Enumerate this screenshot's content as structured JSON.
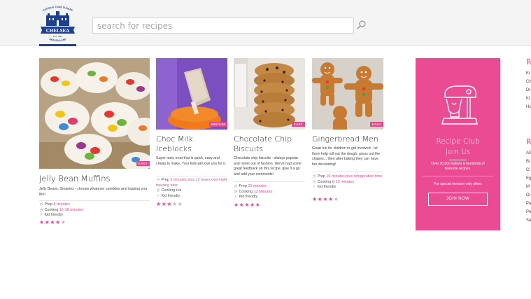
{
  "header": {
    "logo": {
      "top_text": "NATIONAL CANE SUGARS",
      "brand": "CHELSEA",
      "est": "EST. 1884",
      "bottom_text": "NEW ZEALAND"
    },
    "search_placeholder": "search for recipes"
  },
  "recipes": [
    {
      "title": "Jelly Bean Muffins",
      "badge": "EASY",
      "description": "Jelly Beans, Smarties - choose whatever sprinkles and topping you like!",
      "prep_label": "Prep",
      "prep_value": "8 minutes",
      "cooking_label": "Cooking",
      "cooking_value": "15-18 minutes",
      "kid": "Kid friendly",
      "rating": 4,
      "rating_max": 5
    },
    {
      "title": "Choc Milk Iceblocks",
      "badge": "MEDIUM",
      "description": "Super tasty treat that is quick, easy and cheap to make. Your kids will love you for it.",
      "prep_label": "Prep",
      "prep_value": "5 minutes plus 12 hours overnight freezing time",
      "cooking_label": "Cooking",
      "cooking_value": "n/a",
      "kid": "Kid friendly",
      "rating": 3,
      "rating_max": 5
    },
    {
      "title": "Chocolate Chip Biscuits",
      "badge": "EASY",
      "description": "Chocolate chip biscuits - always popular and never out of fashion. We've had some great feedback on this recipe, give it a go and add your comments!",
      "prep_label": "Prep",
      "prep_value": "20 minutes",
      "cooking_label": "Cooking",
      "cooking_value": "12 Minutes",
      "kid": "Kid friendly",
      "rating": 5,
      "rating_max": 5
    },
    {
      "title": "Gingerbread Men",
      "badge": "EASY",
      "description": "Great fun for children to get involved - let them help roll out the dough, press out the shapes... then after baking they can have fun decorating!",
      "prep_label": "Prep",
      "prep_value": "15 minutes plus refrigeration time",
      "cooking_label": "Cooking",
      "cooking_value": "8-10 minutes",
      "kid": "Kid friendly",
      "rating": 4,
      "rating_max": 5
    }
  ],
  "club": {
    "title": "Recipe Club",
    "subtitle": "Join Us",
    "description": "Over 20,000 bakers & hundreds of favourite recipes.",
    "offer": "For special member only offers",
    "button": "JOIN NOW"
  },
  "side": {
    "head1": "R",
    "items1": [
      "Ki",
      "Ch",
      "Dr",
      "Ki",
      "Ho"
    ],
    "head2": "R",
    "items2": [
      "All",
      "Bi",
      "Ci",
      "Eg",
      "M",
      "Oi",
      "Pa",
      "Pe",
      "Sa"
    ]
  },
  "colors": {
    "accent": "#e44890",
    "club_bg": "#ea4b93",
    "brand_navy": "#1f3f8f"
  }
}
